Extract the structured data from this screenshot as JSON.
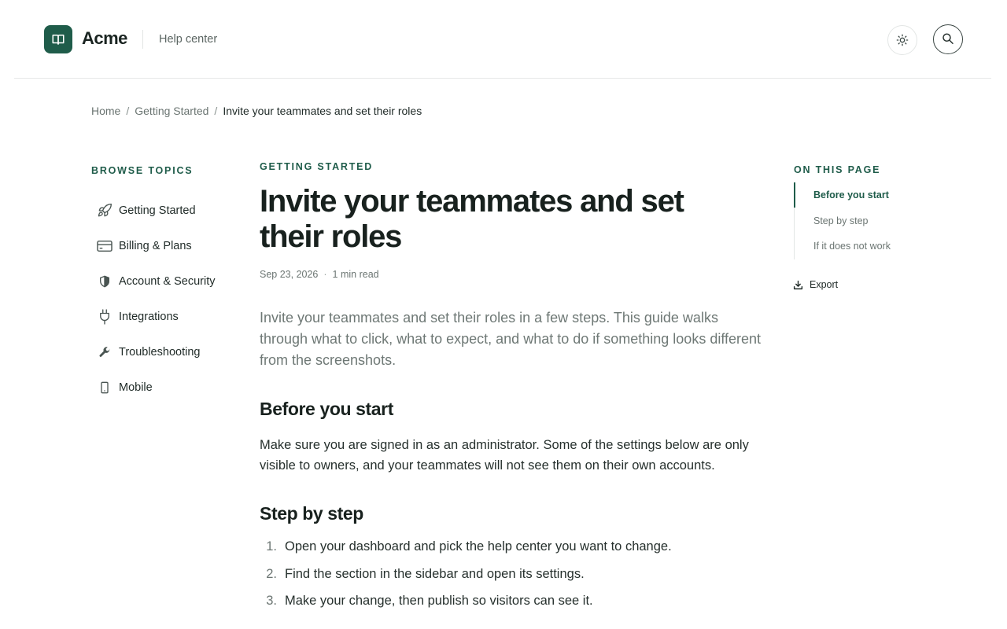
{
  "header": {
    "brand": "Acme",
    "section": "Help center",
    "icons": {
      "logo": "book-icon",
      "theme": "sun-icon",
      "search": "search-icon"
    }
  },
  "breadcrumb": {
    "items": [
      "Home",
      "Getting Started"
    ],
    "current": "Invite your teammates and set their roles",
    "separator": "/"
  },
  "sidebar": {
    "title": "BROWSE TOPICS",
    "items": [
      {
        "label": "Getting Started",
        "icon": "rocket-icon"
      },
      {
        "label": "Billing & Plans",
        "icon": "credit-card-icon"
      },
      {
        "label": "Account & Security",
        "icon": "shield-icon"
      },
      {
        "label": "Integrations",
        "icon": "plug-icon"
      },
      {
        "label": "Troubleshooting",
        "icon": "wrench-icon"
      },
      {
        "label": "Mobile",
        "icon": "phone-icon"
      }
    ]
  },
  "article": {
    "category": "GETTING STARTED",
    "title": "Invite your teammates and set their roles",
    "date": "Sep 23, 2026",
    "read_time": "1 min read",
    "lead": "Invite your teammates and set their roles in a few steps. This guide walks through what to click, what to expect, and what to do if something looks different from the screenshots.",
    "sections": [
      {
        "heading": "Before you start",
        "body": "Make sure you are signed in as an administrator. Some of the settings below are only visible to owners, and your teammates will not see them on their own accounts."
      },
      {
        "heading": "Step by step",
        "steps": [
          {
            "num": "1.",
            "text": "Open your dashboard and pick the help center you want to change."
          },
          {
            "num": "2.",
            "text": "Find the section in the sidebar and open its settings."
          },
          {
            "num": "3.",
            "text": "Make your change, then publish so visitors can see it."
          }
        ]
      }
    ]
  },
  "toc": {
    "title": "ON THIS PAGE",
    "items": [
      "Before you start",
      "Step by step",
      "If it does not work"
    ],
    "active": "Before you start",
    "export_label": "Export",
    "export_icon": "download-icon"
  },
  "colors": {
    "accent": "#1f5c4a",
    "text": "#1f2a27",
    "muted": "#6b7572"
  }
}
